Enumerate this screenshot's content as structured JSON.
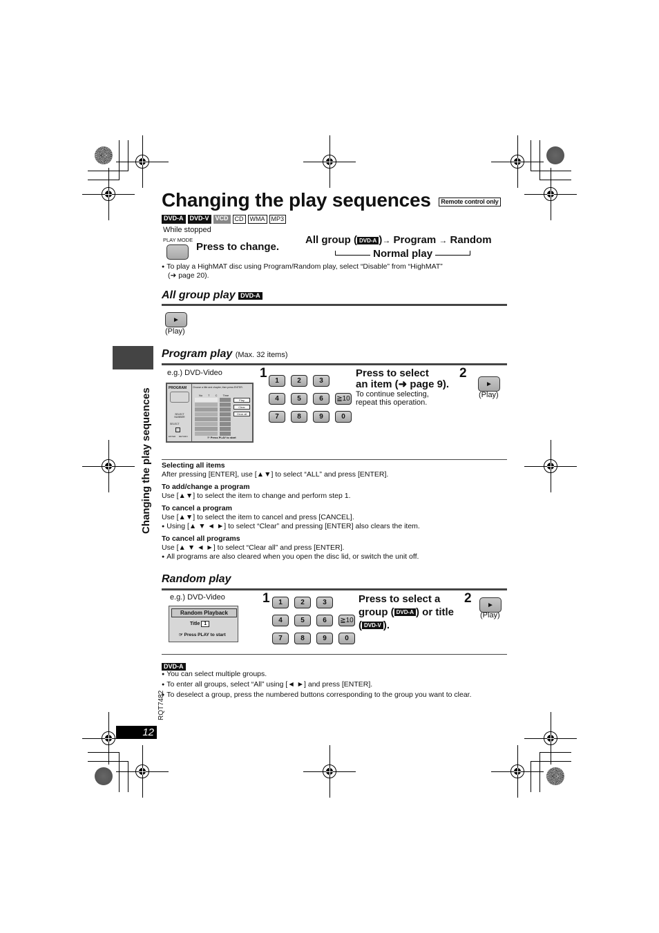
{
  "page": {
    "title": "Changing the play sequences",
    "remote_badge": "Remote control only",
    "disc_types": [
      {
        "label": "DVD-A",
        "style": "dark"
      },
      {
        "label": "DVD-V",
        "style": "dark"
      },
      {
        "label": "VCD",
        "style": "gray"
      },
      {
        "label": "CD",
        "style": "outline"
      },
      {
        "label": "WMA",
        "style": "outline"
      },
      {
        "label": "MP3",
        "style": "outline"
      }
    ],
    "while_stopped": "While stopped",
    "play_mode_label": "PLAY MODE",
    "press_to_change": "Press to change.",
    "sequence": {
      "all_group": "All group (",
      "dvd_a": "DVD-A",
      "close_paren": ")",
      "arrow": "→",
      "program": "Program",
      "random": "Random",
      "normal_play": "Normal play"
    },
    "highmat_note_line1": "To play a HighMAT disc using Program/Random play, select “Disable” from “HighMAT”",
    "highmat_note_line2": "(➜ page 20).",
    "sidebar_title": "Changing the play sequences",
    "doc_code": "RQT7482",
    "page_number": "12"
  },
  "all_group": {
    "title": "All group play",
    "badge": "DVD-A",
    "play_symbol": "►",
    "play_label": "(Play)"
  },
  "program": {
    "title": "Program play",
    "subtitle": "(Max. 32 items)",
    "example": "e.g.) DVD-Video",
    "step1": "1",
    "step2": "2",
    "keys": [
      "1",
      "2",
      "3",
      "4",
      "5",
      "6",
      "≧10",
      "7",
      "8",
      "9",
      "0"
    ],
    "instr_line1": "Press to select",
    "instr_line2": "an item (➜ page 9).",
    "instr_sub1": "To continue selecting,",
    "instr_sub2": "repeat this operation.",
    "play_symbol": "►",
    "play_label": "(Play)",
    "screen": {
      "header": "PROGRAM",
      "hint": "Choose a title and chapter, then press ENTER.",
      "cols": [
        "No",
        "T",
        "C",
        "Time"
      ],
      "first_no": "1",
      "buttons": [
        "Play",
        "Clear",
        "Clear all"
      ],
      "select_label": "SELECT NUMBER",
      "select2": "SELECT",
      "enter": "ENTER",
      "return": "RETURN",
      "footer": "Press PLAY to start"
    }
  },
  "notes": [
    {
      "heading": "Selecting all items",
      "lines": [
        "After pressing [ENTER], use [▲▼] to select “ALL” and press [ENTER]."
      ]
    },
    {
      "heading": "To add/change a program",
      "lines": [
        "Use [▲▼] to select the item to change and perform step 1."
      ]
    },
    {
      "heading": "To cancel a program",
      "lines": [
        "Use [▲▼] to select the item to cancel and press [CANCEL].",
        "Using [▲ ▼ ◄ ►] to select “Clear” and pressing [ENTER] also clears the item."
      ]
    },
    {
      "heading": "To cancel all programs",
      "lines": [
        "Use [▲ ▼ ◄ ►] to select “Clear all” and press [ENTER].",
        "All programs are also cleared when you open the disc lid, or switch the unit off."
      ]
    }
  ],
  "random": {
    "title": "Random play",
    "example": "e.g.) DVD-Video",
    "step1": "1",
    "step2": "2",
    "keys": [
      "1",
      "2",
      "3",
      "4",
      "5",
      "6",
      "≧10",
      "7",
      "8",
      "9",
      "0"
    ],
    "instr_line1": "Press to select a",
    "instr_line2a": "group (",
    "instr_badge_a": "DVD-A",
    "instr_line2b": ") or title",
    "instr_line3a": "(",
    "instr_badge_v": "DVD-V",
    "instr_line3b": ").",
    "play_symbol": "►",
    "play_label": "(Play)",
    "screen": {
      "header": "Random Playback",
      "title_label": "Title",
      "title_value": "1",
      "footer": "Press PLAY to start"
    },
    "dvd_a_badge": "DVD-A",
    "bullets": [
      "You can select multiple groups.",
      "To enter all groups, select “All” using [◄ ►] and press [ENTER].",
      "To deselect a group, press the numbered buttons corresponding to the group you want to clear."
    ]
  }
}
